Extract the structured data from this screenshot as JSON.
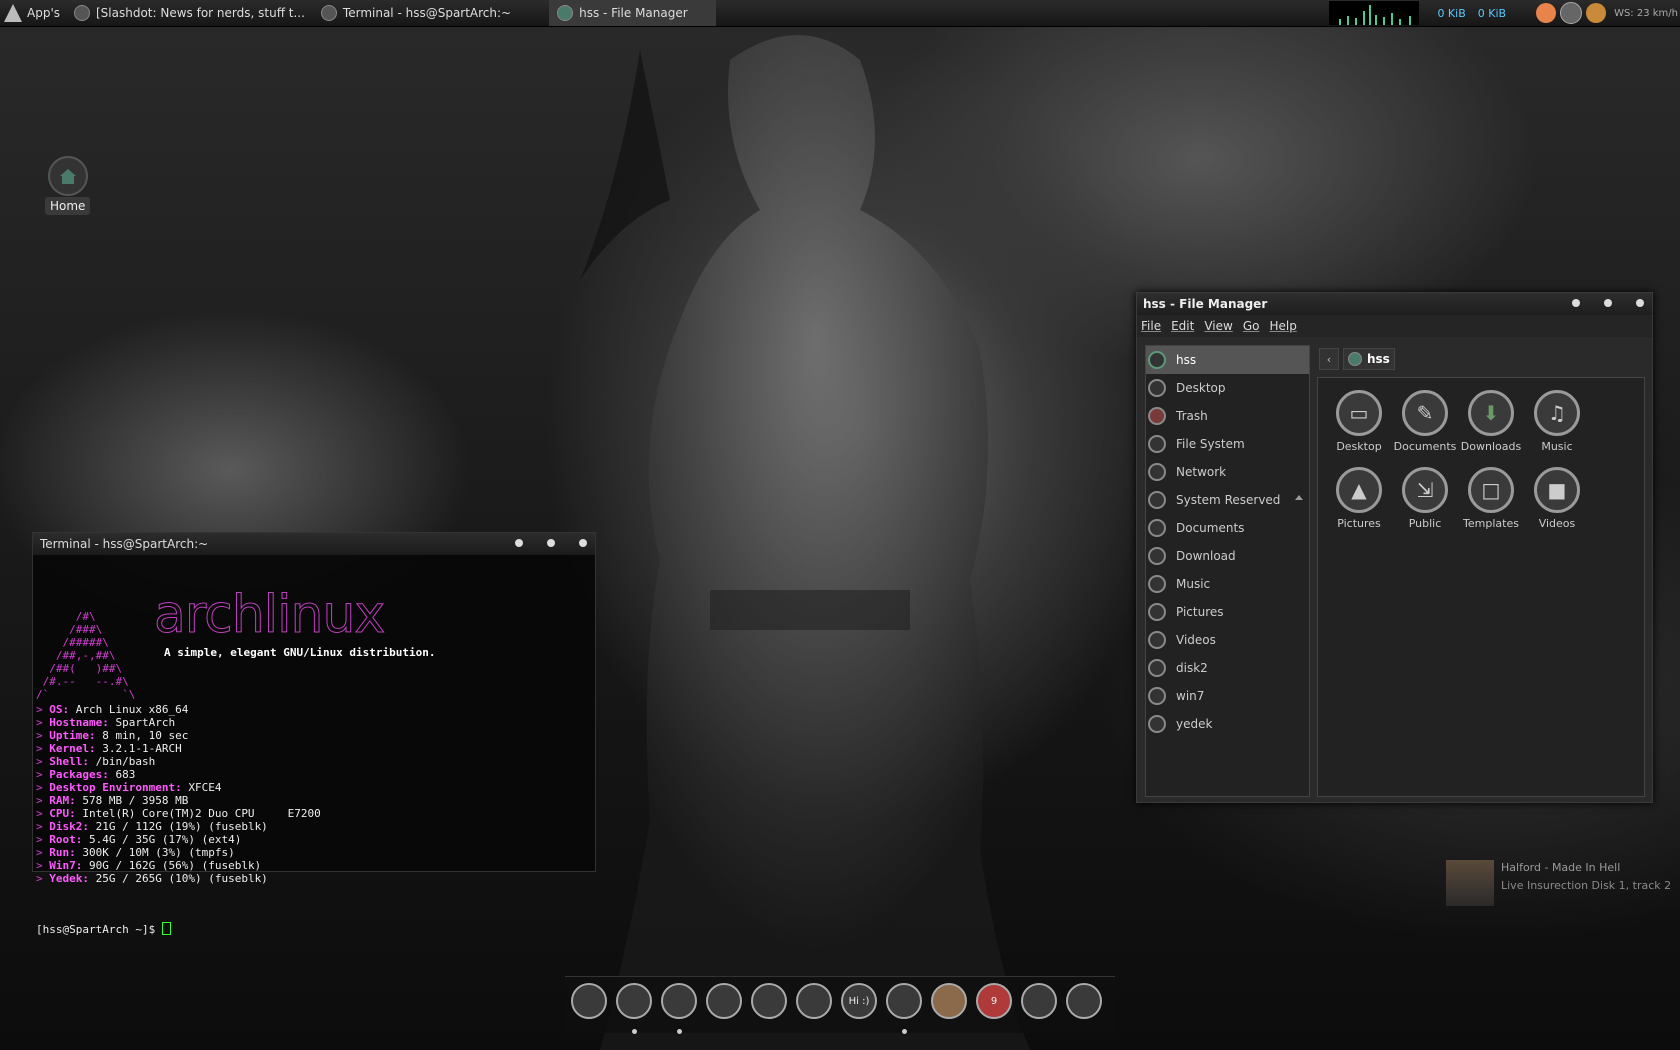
{
  "top_panel": {
    "apps_label": "App's",
    "tasks": [
      {
        "label": "[Slashdot: News for nerds, stuff t..."
      },
      {
        "label": "Terminal - hss@SpartArch:~"
      },
      {
        "label": "hss - File Manager"
      }
    ],
    "net_down": "0 KiB",
    "net_up": "0 KiB",
    "weather": "WS: 23 km/h"
  },
  "desktop": {
    "home_label": "Home"
  },
  "terminal": {
    "title": "Terminal - hss@SpartArch:~",
    "logo_word": "archlinux",
    "tagline": "A simple, elegant GNU/Linux distribution.",
    "ascii": [
      "      /#\\",
      "     /###\\",
      "    /#####\\",
      "   /##,-,##\\",
      "  /##(   )##\\",
      " /#.--   --.#\\",
      "/`           `\\"
    ],
    "info": [
      {
        "key": "OS:",
        "val": " Arch Linux x86_64"
      },
      {
        "key": "Hostname:",
        "val": " SpartArch"
      },
      {
        "key": "Uptime:",
        "val": " 8 min, 10 sec"
      },
      {
        "key": "Kernel:",
        "val": " 3.2.1-1-ARCH"
      },
      {
        "key": "Shell:",
        "val": " /bin/bash"
      },
      {
        "key": "Packages:",
        "val": " 683"
      },
      {
        "key": "Desktop Environment:",
        "val": " XFCE4"
      },
      {
        "key": "RAM:",
        "val": " 578 MB / 3958 MB"
      },
      {
        "key": "CPU:",
        "val": " Intel(R) Core(TM)2 Duo CPU     E7200"
      },
      {
        "key": "Disk2:",
        "val": " 21G / 112G (19%) (fuseblk)"
      },
      {
        "key": "Root:",
        "val": " 5.4G / 35G (17%) (ext4)"
      },
      {
        "key": "Run:",
        "val": " 300K / 10M (3%) (tmpfs)"
      },
      {
        "key": "Win7:",
        "val": " 90G / 162G (56%) (fuseblk)"
      },
      {
        "key": "Yedek:",
        "val": " 25G / 265G (10%) (fuseblk)"
      }
    ],
    "prompt": "[hss@SpartArch ~]$ "
  },
  "file_manager": {
    "title": "hss - File Manager",
    "menu": [
      "File",
      "Edit",
      "View",
      "Go",
      "Help"
    ],
    "side": [
      {
        "label": "hss",
        "icon": "home-icon"
      },
      {
        "label": "Desktop",
        "icon": "desktop-icon"
      },
      {
        "label": "Trash",
        "icon": "trash-icon"
      },
      {
        "label": "File System",
        "icon": "drive-icon"
      },
      {
        "label": "Network",
        "icon": "network-icon"
      },
      {
        "label": "System Reserved",
        "icon": "drive-icon"
      },
      {
        "label": "Documents",
        "icon": "documents-icon"
      },
      {
        "label": "Download",
        "icon": "download-icon"
      },
      {
        "label": "Music",
        "icon": "music-icon"
      },
      {
        "label": "Pictures",
        "icon": "pictures-icon"
      },
      {
        "label": "Videos",
        "icon": "videos-icon"
      },
      {
        "label": "disk2",
        "icon": "folder-icon"
      },
      {
        "label": "win7",
        "icon": "folder-icon"
      },
      {
        "label": "yedek",
        "icon": "folder-icon"
      }
    ],
    "path": "hss",
    "items": [
      {
        "label": "Desktop",
        "icon": "desktop-icon"
      },
      {
        "label": "Documents",
        "icon": "documents-icon"
      },
      {
        "label": "Downloads",
        "icon": "download-icon"
      },
      {
        "label": "Music",
        "icon": "music-icon"
      },
      {
        "label": "Pictures",
        "icon": "pictures-icon"
      },
      {
        "label": "Public",
        "icon": "public-icon"
      },
      {
        "label": "Templates",
        "icon": "templates-icon"
      },
      {
        "label": "Videos",
        "icon": "videos-icon"
      }
    ]
  },
  "now_playing": {
    "title": "Halford - Made In Hell",
    "subtitle": "Live Insurection Disk 1, track 2"
  },
  "dock": {
    "items": [
      {
        "icon": "search-icon"
      },
      {
        "icon": "terminal-icon"
      },
      {
        "icon": "chrome-icon"
      },
      {
        "icon": "gimp-icon"
      },
      {
        "icon": "firefox-icon"
      },
      {
        "icon": "debian-icon"
      },
      {
        "icon": "chat-icon",
        "label": "Hi :)"
      },
      {
        "icon": "monitor-icon"
      },
      {
        "icon": "moon-icon"
      },
      {
        "icon": "lastfm-icon",
        "badge": "9"
      },
      {
        "icon": "folder-icon"
      },
      {
        "icon": "mixer-icon"
      }
    ]
  }
}
